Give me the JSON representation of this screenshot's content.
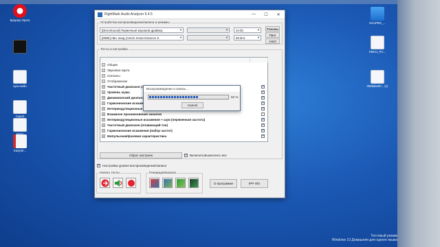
{
  "desktop": {
    "left_icons": [
      {
        "label": "Браузер Opera",
        "icon": "opera-icon"
      },
      {
        "label": "",
        "icon": "black-window-icon"
      },
      {
        "label": "ауш-audio",
        "icon": "document-icon"
      },
      {
        "label": "Cepart",
        "icon": "document-icon"
      },
      {
        "label": "BIOS",
        "icon": "document-icon"
      },
      {
        "label": "EasyStr...",
        "icon": "pdf-icon"
      }
    ],
    "right_icons": [
      {
        "label": "EmuPMX_...",
        "icon": "app-icon"
      },
      {
        "label": "EMUU_PC...",
        "icon": "document-icon"
      },
      {
        "label": "0089abe00... (1)",
        "icon": "document-icon"
      }
    ],
    "watermark_line1": "Тестовый режим",
    "watermark_line2": "Windows 10 Домашняя для одного языка"
  },
  "window": {
    "title": "RightMark Audio Analyzer 6.4.5",
    "devices_group": "Устройства воспроизведения/записи и режимы",
    "playback_device": "[DirectSound] Первичный звуковой драйвер",
    "record_device": "[MME] Лин. вход (ASUS Xonar Essence S",
    "bit_depth": "24 bit",
    "sample_rate": "96 kHz",
    "btn_modes": "Режимы",
    "btn_loop": "Пинг",
    "btn_asio": "ASIO",
    "tests_group": "Тесты и настройки",
    "tree_items": [
      {
        "label": "Общие",
        "bold": false,
        "checked": false
      },
      {
        "label": "Звуковая карта",
        "bold": false,
        "checked": false
      },
      {
        "label": "Сигналы",
        "bold": false,
        "checked": false
      },
      {
        "label": "Отображение",
        "bold": false,
        "checked": false
      },
      {
        "label": "Частотный диапазон (лин. сигнал)",
        "bold": true,
        "checked": true
      },
      {
        "label": "Уровень шума",
        "bold": true,
        "checked": true
      },
      {
        "label": "Динамический диапазон",
        "bold": true,
        "checked": true
      },
      {
        "label": "Гармонические искажения",
        "bold": true,
        "checked": true
      },
      {
        "label": "Интермодуляционные искажения",
        "bold": true,
        "checked": true
      },
      {
        "label": "Взаимное проникновение каналов",
        "bold": true,
        "checked": false
      },
      {
        "label": "Интермодуляционные искажения + шум (переменная частота)",
        "bold": true,
        "checked": true
      },
      {
        "label": "Частотный диапазон (плавающий тон)",
        "bold": true,
        "checked": true
      },
      {
        "label": "Гармонические искажения (набор частот)",
        "bold": true,
        "checked": true
      },
      {
        "label": "Импульсная/фазовая характеристика",
        "bold": true,
        "checked": true
      }
    ],
    "btn_reset": "Сброс настроек",
    "enable_all_label": "Включить/выключить все",
    "level_setup_label": "Настройка уровня воспроизведения/записи",
    "start_group": "Начать тесты",
    "gen_group": "Генерация/анализ",
    "btn_about": "О программе",
    "btn_ipp": "IPP Info"
  },
  "progress_dialog": {
    "title": "Воспроизведение и запись...",
    "percent_label": "62 %",
    "progress": 0.62,
    "btn_cancel": "Cancel"
  },
  "colors": {
    "accent": "#1f57b8",
    "record": "#e3232f"
  }
}
